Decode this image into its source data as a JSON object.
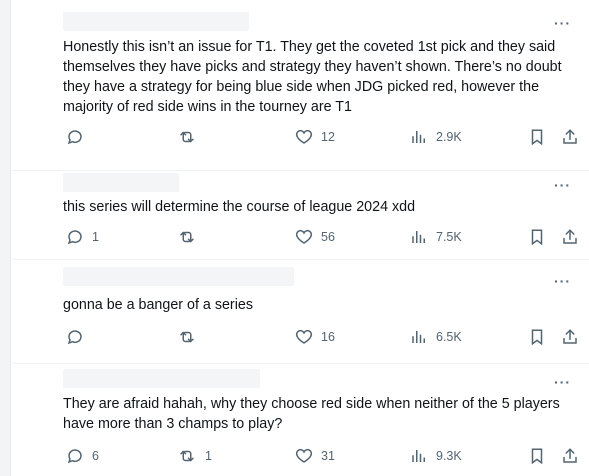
{
  "replies": [
    {
      "text": "Honestly this isn’t an issue for T1.  They get the coveted 1st pick and they said themselves they have picks and strategy they haven’t shown. There’s no doubt they have a strategy for being blue side when JDG picked red, however the majority of red side wins in the tourney are T1",
      "replies_count": "",
      "reposts": "",
      "likes": "12",
      "views": "2.9K"
    },
    {
      "text": "this series will determine the course of league 2024 xdd",
      "replies_count": "1",
      "reposts": "",
      "likes": "56",
      "views": "7.5K"
    },
    {
      "text": "gonna be a banger of a series",
      "replies_count": "",
      "reposts": "",
      "likes": "16",
      "views": "6.5K"
    },
    {
      "text": "They are afraid hahah, why they choose red side when neither of the 5 players have more than 3 champs to play?",
      "replies_count": "6",
      "reposts": "1",
      "likes": "31",
      "views": "9.3K"
    }
  ],
  "more_glyph": "···",
  "icons": [
    "reply-icon",
    "repost-icon",
    "like-icon",
    "views-icon",
    "bookmark-icon",
    "share-icon"
  ],
  "colors": {
    "text": "#0f1419",
    "muted": "#536471",
    "divider": "#eff3f4"
  }
}
